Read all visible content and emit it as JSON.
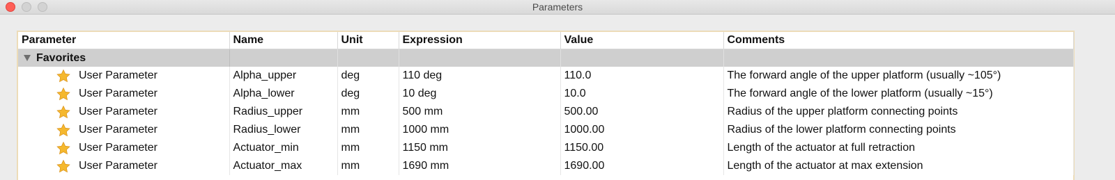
{
  "window": {
    "title": "Parameters"
  },
  "table": {
    "columns": [
      "Parameter",
      "Name",
      "Unit",
      "Expression",
      "Value",
      "Comments"
    ],
    "group": {
      "label": "Favorites",
      "expanded": true
    },
    "rows": [
      {
        "parameter": "User Parameter",
        "name": "Alpha_upper",
        "unit": "deg",
        "expression": "110 deg",
        "value": "110.0",
        "comments": "The forward angle of the upper platform (usually ~105°)"
      },
      {
        "parameter": "User Parameter",
        "name": "Alpha_lower",
        "unit": "deg",
        "expression": "10 deg",
        "value": "10.0",
        "comments": "The forward angle of the lower platform (usually ~15°)"
      },
      {
        "parameter": "User Parameter",
        "name": "Radius_upper",
        "unit": "mm",
        "expression": "500 mm",
        "value": "500.00",
        "comments": "Radius of the upper platform connecting points"
      },
      {
        "parameter": "User Parameter",
        "name": "Radius_lower",
        "unit": "mm",
        "expression": "1000 mm",
        "value": "1000.00",
        "comments": "Radius of the lower platform connecting points"
      },
      {
        "parameter": "User Parameter",
        "name": "Actuator_min",
        "unit": "mm",
        "expression": "1150 mm",
        "value": "1150.00",
        "comments": "Length of the actuator at full retraction"
      },
      {
        "parameter": "User Parameter",
        "name": "Actuator_max",
        "unit": "mm",
        "expression": "1690 mm",
        "value": "1690.00",
        "comments": "Length of the actuator at max extension"
      }
    ]
  },
  "icons": {
    "favorite": "star-icon",
    "disclosure": "triangle-down-icon"
  },
  "colors": {
    "star": "#f5b82e",
    "group_background": "#cfcfcf",
    "frame_border": "#eddcb8",
    "close_button": "#ff5f57"
  }
}
